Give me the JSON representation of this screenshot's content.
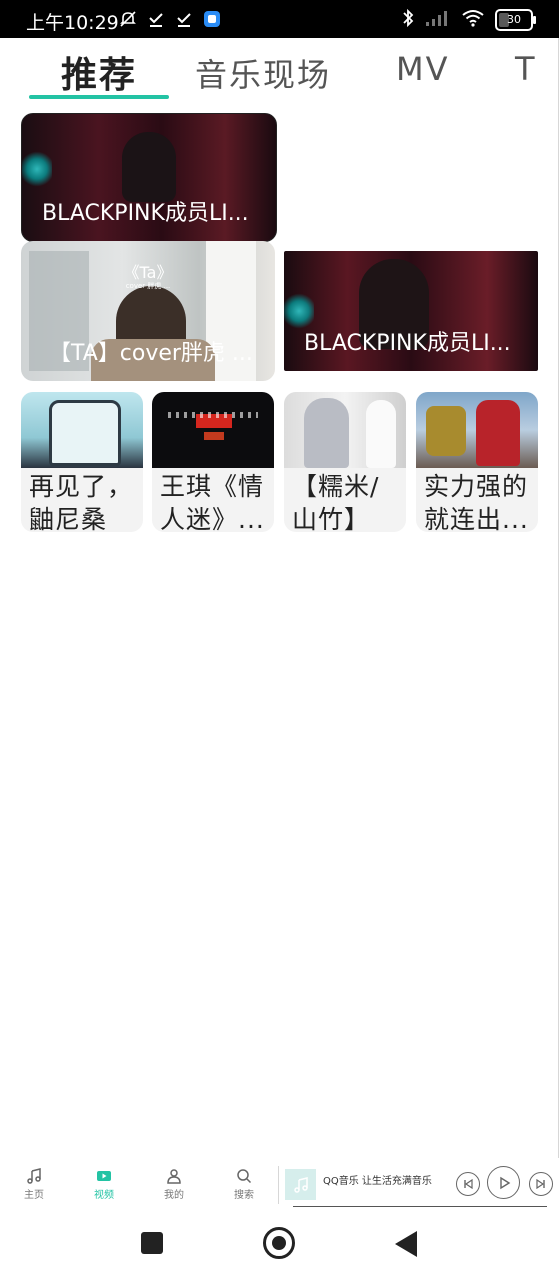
{
  "status_bar": {
    "time": "上午10:29",
    "battery": "30"
  },
  "tabs": [
    {
      "label": "推荐",
      "active": true
    },
    {
      "label": "音乐现场",
      "active": false
    },
    {
      "label": "MV",
      "active": false
    },
    {
      "label": "T",
      "active": false
    }
  ],
  "featured": [
    {
      "title": "BLACKPINK成员LI..."
    },
    {
      "title": "【TA】cover胖虎 ...",
      "overlay_top": "《Ta》",
      "overlay_sub": "cover 胖虎 ..."
    },
    {
      "title": "BLACKPINK成员LI..."
    }
  ],
  "small_cards": [
    {
      "title": "再见了，鼬尼桑"
    },
    {
      "title": "王琪《情人迷》..."
    },
    {
      "title": "【糯米/山竹】翻..."
    },
    {
      "title": "实力强的就连出..."
    }
  ],
  "bottom_nav": [
    {
      "label": "主页",
      "icon": "music-note-icon",
      "active": false
    },
    {
      "label": "视频",
      "icon": "video-play-icon",
      "active": true
    },
    {
      "label": "我的",
      "icon": "user-icon",
      "active": false
    },
    {
      "label": "搜索",
      "icon": "search-icon",
      "active": false
    }
  ],
  "mini_player": {
    "title": "QQ音乐 让生活充满音乐"
  },
  "colors": {
    "accent": "#23c3a4",
    "status_bar": "#000000"
  }
}
